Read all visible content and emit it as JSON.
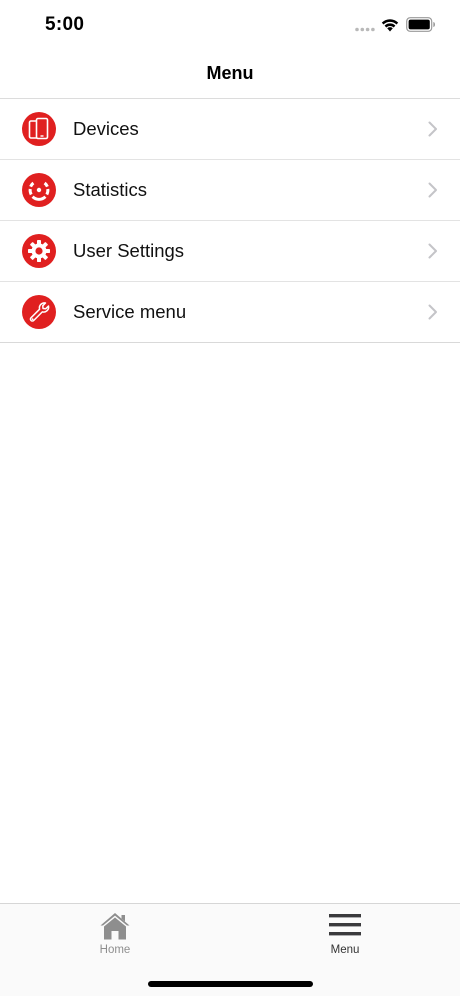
{
  "status_bar": {
    "time": "5:00"
  },
  "nav": {
    "title": "Menu"
  },
  "menu": {
    "items": [
      {
        "label": "Devices",
        "icon": "devices-icon"
      },
      {
        "label": "Statistics",
        "icon": "statistics-gauge-icon"
      },
      {
        "label": "User Settings",
        "icon": "gear-icon"
      },
      {
        "label": "Service menu",
        "icon": "wrench-icon"
      }
    ]
  },
  "tab_bar": {
    "home_label": "Home",
    "menu_label": "Menu",
    "active_tab": "Menu"
  },
  "colors": {
    "accent": "#e02020",
    "chevron": "#c4c4c8",
    "inactive_tab": "#8e8e8e",
    "active_tab": "#3a3a3c"
  }
}
